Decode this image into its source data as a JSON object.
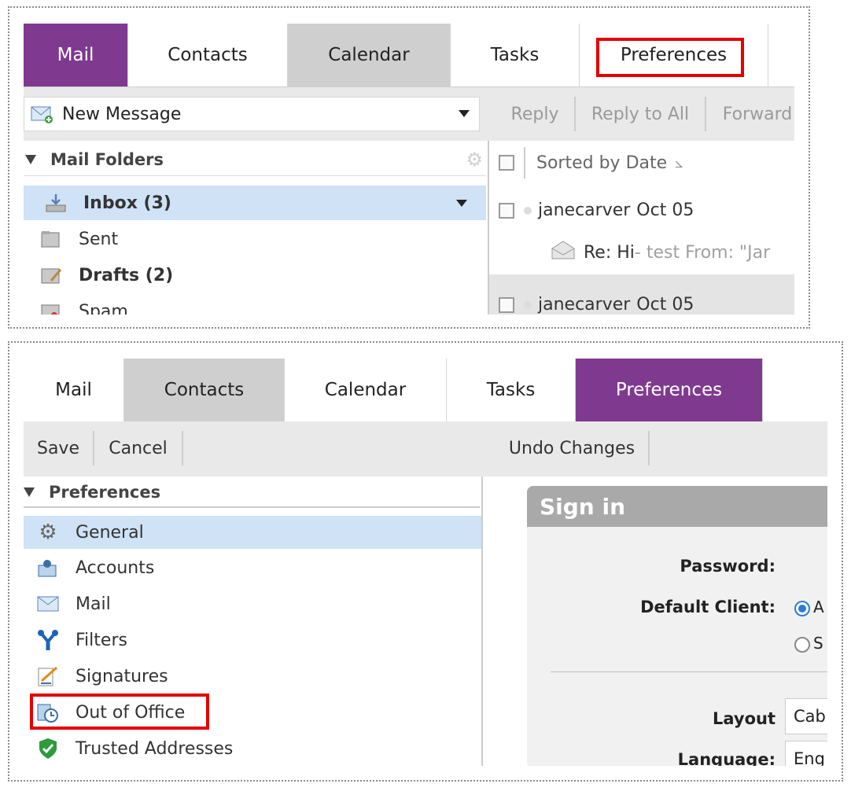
{
  "top": {
    "tabs": [
      "Mail",
      "Contacts",
      "Calendar",
      "Tasks",
      "Preferences"
    ],
    "toolbar": {
      "new_message": "New Message",
      "reply": "Reply",
      "reply_all": "Reply to All",
      "forward": "Forward"
    },
    "folders": {
      "heading": "Mail Folders",
      "items": [
        {
          "label": "Inbox (3)",
          "icon": "inbox-icon"
        },
        {
          "label": "Sent",
          "icon": "sent-icon"
        },
        {
          "label": "Drafts (2)",
          "icon": "drafts-icon"
        },
        {
          "label": "Spam",
          "icon": "spam-icon"
        }
      ]
    },
    "messages": {
      "sort_label": "Sorted by Date",
      "items": [
        {
          "sender": "janecarver",
          "date": "Oct 05",
          "subject": "Re: Hi",
          "preview": " - test From: \"Jar"
        },
        {
          "sender": "janecarver",
          "date": "Oct 05"
        }
      ]
    }
  },
  "bottom": {
    "tabs": [
      "Mail",
      "Contacts",
      "Calendar",
      "Tasks",
      "Preferences"
    ],
    "toolbar": {
      "save": "Save",
      "cancel": "Cancel",
      "undo": "Undo Changes"
    },
    "prefs": {
      "heading": "Preferences",
      "items": [
        {
          "label": "General",
          "icon": "gear-icon"
        },
        {
          "label": "Accounts",
          "icon": "accounts-icon"
        },
        {
          "label": "Mail",
          "icon": "mail-icon"
        },
        {
          "label": "Filters",
          "icon": "filter-icon"
        },
        {
          "label": "Signatures",
          "icon": "signature-icon"
        },
        {
          "label": "Out of Office",
          "icon": "out-of-office-icon"
        },
        {
          "label": "Trusted Addresses",
          "icon": "shield-icon"
        }
      ]
    },
    "signin": {
      "title": "Sign in",
      "password_label": "Password:",
      "default_client_label": "Default Client:",
      "radio_a": "A",
      "radio_s": "S",
      "layout_label": "Layout",
      "layout_value": "Cab",
      "language_label": "Language:",
      "language_value": "Eng"
    }
  },
  "colors": {
    "accent": "#7f3a8f",
    "highlight": "#e50000",
    "selection": "#cfe2f6"
  }
}
